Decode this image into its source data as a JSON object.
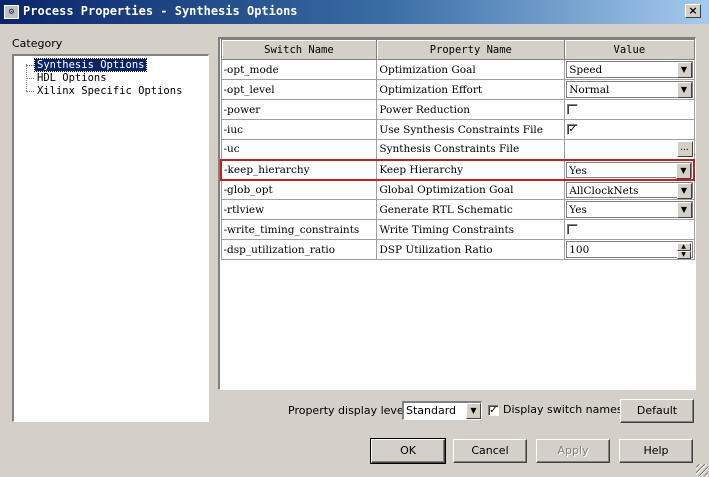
{
  "window": {
    "title": "Process Properties - Synthesis Options",
    "icon": "app-icon",
    "close_label": "×"
  },
  "category": {
    "label": "Category",
    "items": [
      {
        "label": "Synthesis Options",
        "selected": true
      },
      {
        "label": "HDL Options",
        "selected": false
      },
      {
        "label": "Xilinx Specific Options",
        "selected": false
      }
    ]
  },
  "grid": {
    "headers": [
      "Switch Name",
      "Property Name",
      "Value"
    ],
    "rows": [
      {
        "switch": "-opt_mode",
        "property": "Optimization Goal",
        "value": "Speed",
        "control": "combo"
      },
      {
        "switch": "-opt_level",
        "property": "Optimization Effort",
        "value": "Normal",
        "control": "combo"
      },
      {
        "switch": "-power",
        "property": "Power Reduction",
        "value": "",
        "control": "checkbox",
        "checked": false
      },
      {
        "switch": "-iuc",
        "property": "Use Synthesis Constraints File",
        "value": "",
        "control": "checkbox",
        "checked": true
      },
      {
        "switch": "-uc",
        "property": "Synthesis Constraints File",
        "value": "",
        "control": "browse"
      },
      {
        "switch": "-keep_hierarchy",
        "property": "Keep Hierarchy",
        "value": "Yes",
        "control": "combo",
        "highlighted": true
      },
      {
        "switch": "-glob_opt",
        "property": "Global Optimization Goal",
        "value": "AllClockNets",
        "control": "combo"
      },
      {
        "switch": "-rtlview",
        "property": "Generate RTL Schematic",
        "value": "Yes",
        "control": "combo"
      },
      {
        "switch": "-write_timing_constraints",
        "property": "Write Timing Constraints",
        "value": "",
        "control": "checkbox",
        "checked": false
      },
      {
        "switch": "-dsp_utilization_ratio",
        "property": "DSP Utilization Ratio",
        "value": "100",
        "control": "spin"
      }
    ]
  },
  "footer": {
    "display_level_label": "Property display level:",
    "display_level_value": "Standard",
    "display_switch_label": "Display switch names",
    "display_switch_checked": true,
    "default_button": "Default",
    "ok_button": "OK",
    "cancel_button": "Cancel",
    "apply_button": "Apply",
    "help_button": "Help"
  },
  "colors": {
    "highlight_border": "#c02020",
    "selection": "#0a246a"
  }
}
